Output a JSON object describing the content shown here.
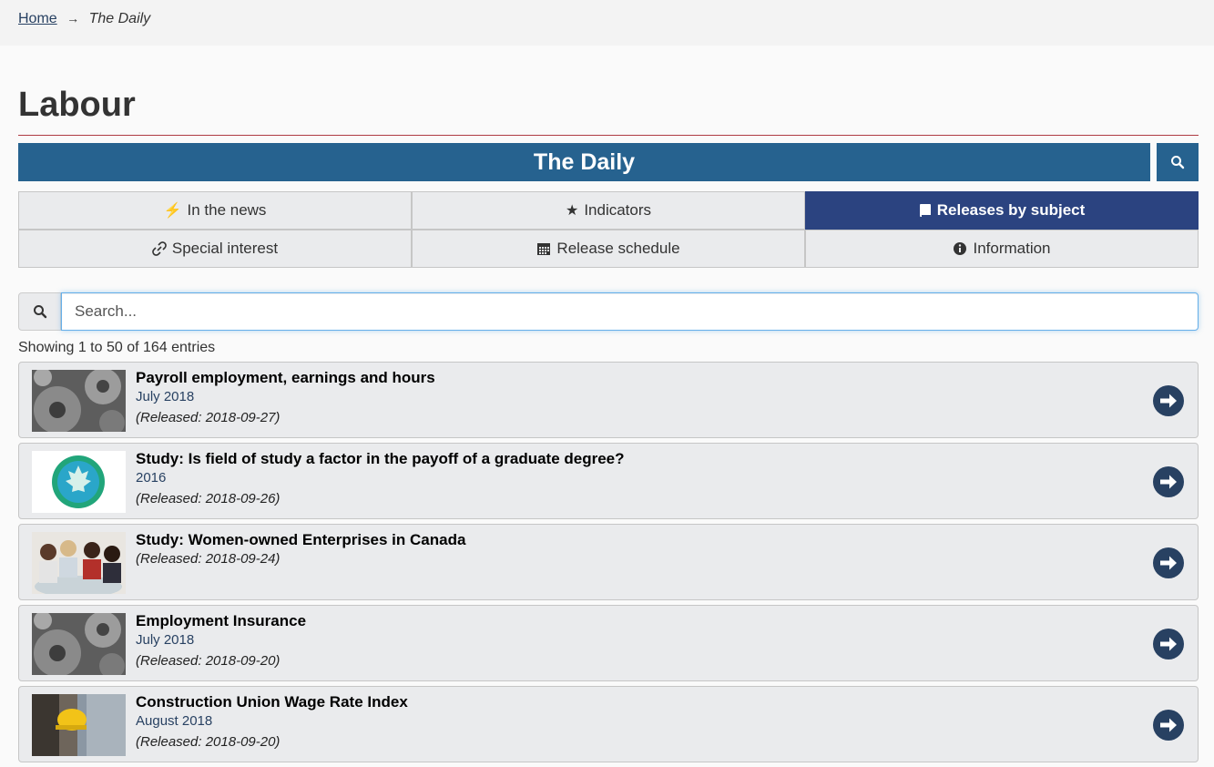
{
  "breadcrumb": {
    "home": "Home",
    "separator": "→",
    "current": "The Daily"
  },
  "page": {
    "title": "Labour"
  },
  "daily": {
    "title": "The Daily",
    "search_icon": "search-icon"
  },
  "tabs": [
    {
      "label": "In the news",
      "icon": "bolt-icon",
      "glyph": "⚡",
      "active": false
    },
    {
      "label": "Indicators",
      "icon": "star-icon",
      "glyph": "★",
      "active": false
    },
    {
      "label": "Releases by subject",
      "icon": "book-icon",
      "glyph": "",
      "active": true
    },
    {
      "label": "Special interest",
      "icon": "link-icon",
      "glyph": "🔗",
      "active": false
    },
    {
      "label": "Release schedule",
      "icon": "calendar-icon",
      "glyph": "▦",
      "active": false
    },
    {
      "label": "Information",
      "icon": "info-icon",
      "glyph": "ℹ",
      "active": false
    }
  ],
  "search": {
    "placeholder": "Search...",
    "value": ""
  },
  "results": {
    "summary": "Showing 1 to 50 of 164 entries"
  },
  "items": [
    {
      "title": "Payroll employment, earnings and hours",
      "subtitle": "July 2018",
      "released": "(Released: 2018-09-27)",
      "thumb": "gears-image"
    },
    {
      "title": "Study: Is field of study a factor in the payoff of a graduate degree?",
      "subtitle": "2016",
      "released": "(Released: 2018-09-26)",
      "thumb": "statcan-logo-image"
    },
    {
      "title": "Study: Women-owned Enterprises in Canada",
      "subtitle": "",
      "released": "(Released: 2018-09-24)",
      "thumb": "business-women-image"
    },
    {
      "title": "Employment Insurance",
      "subtitle": "July 2018",
      "released": "(Released: 2018-09-20)",
      "thumb": "gears-image"
    },
    {
      "title": "Construction Union Wage Rate Index",
      "subtitle": "August 2018",
      "released": "(Released: 2018-09-20)",
      "thumb": "hardhat-image"
    }
  ],
  "colors": {
    "daily_bar": "#26628f",
    "active_tab": "#2b4380",
    "rule": "#af3c43",
    "link": "#284162"
  }
}
